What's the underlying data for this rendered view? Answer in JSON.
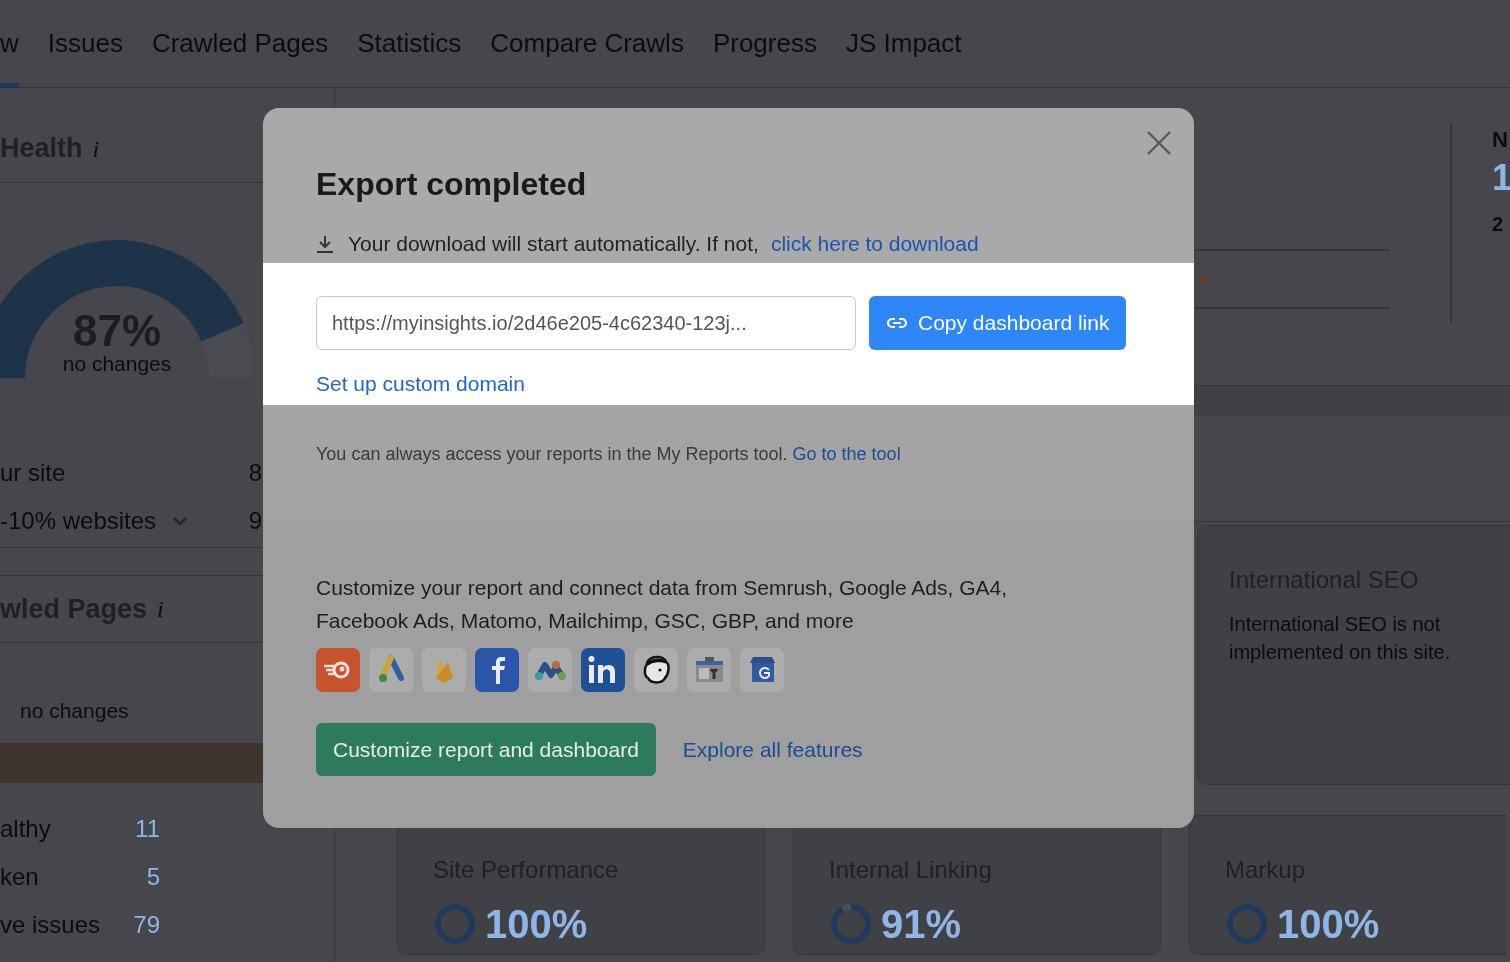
{
  "tabs": [
    {
      "label": "w",
      "selected": true
    },
    {
      "label": "Issues",
      "selected": false
    },
    {
      "label": "Crawled Pages",
      "selected": false
    },
    {
      "label": "Statistics",
      "selected": false
    },
    {
      "label": "Compare Crawls",
      "selected": false
    },
    {
      "label": "Progress",
      "selected": false
    },
    {
      "label": "JS Impact",
      "selected": false
    }
  ],
  "health": {
    "title": "Health",
    "info": "i",
    "score": "87%",
    "score_note": "no changes",
    "level": 0.87,
    "rows": [
      {
        "label": "ur site",
        "value": "8",
        "expandable": false
      },
      {
        "label": "-10% websites",
        "value": "9",
        "expandable": true
      }
    ]
  },
  "crawled_pages": {
    "title": "wled Pages",
    "info": "i",
    "note": "no changes",
    "rows": [
      {
        "label": "althy",
        "value": "11"
      },
      {
        "label": "ken",
        "value": "5"
      },
      {
        "label": "ve issues",
        "value": "79"
      }
    ]
  },
  "side_stat": {
    "heading": "N",
    "value": "1",
    "note": "2"
  },
  "international_seo": {
    "title": "International SEO",
    "text": "International SEO is not implemented on this site."
  },
  "score_cards": [
    {
      "title": "Site Performance",
      "value": "100%",
      "level": 1.0
    },
    {
      "title": "Internal Linking",
      "value": "91%",
      "level": 0.91
    },
    {
      "title": "Markup",
      "value": "100%",
      "level": 1.0
    }
  ],
  "modal": {
    "title": "Export completed",
    "download_text": "Your download will start automatically. If not,",
    "download_link": "click here to download",
    "url_value": "https://myinsights.io/2d46e205-4c62340-123j...",
    "copy_button": "Copy dashboard link",
    "custom_domain_link": "Set up custom domain",
    "reports_text": "You can always access your reports in the My Reports tool.",
    "reports_link": "Go to the tool",
    "promo_text": "Customize your report and connect data from Semrush, Google Ads, GA4, Facebook Ads, Matomo, Mailchimp, GSC, GBP, and more",
    "primary_button": "Customize report and dashboard",
    "secondary_link": "Explore all features"
  }
}
